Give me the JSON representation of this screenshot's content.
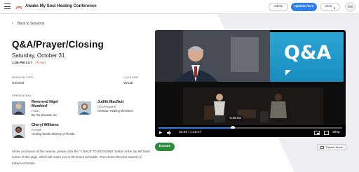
{
  "topbar": {
    "app_title": "Awake My Soul Healing Conference",
    "admin_label": "Admin",
    "update_label": "Update here",
    "view_label": "View",
    "avatar_initials": "KM",
    "accent_color": "#2f7fe8"
  },
  "session": {
    "back_label": "Back to Sessions",
    "title": "Q&A/Prayer/Closing",
    "date": "Saturday, October 31",
    "time": "1:35 PM",
    "timezone": "EDT",
    "duration": "75 min",
    "type_label": "SESSION TYPE",
    "type_value": "General",
    "location_label": "LOCATION",
    "location_value": "Virtual",
    "presenting_label": "PRESENTING",
    "presenters": [
      {
        "name": "Reverend Nigel Mumford",
        "role": "Pastor",
        "org": "By His Wounds, Inc."
      },
      {
        "name": "Judith MacNutt",
        "role": "CEO/President",
        "org": "Christian Healing Ministries"
      },
      {
        "name": "Cheryl Williams",
        "role": "Founder",
        "org": "Healing Words Ministry of Florida"
      }
    ],
    "description": "At the conclusion of this session, please click the \"< BACK TO SESSIONS\" button in the top left hand corner of this page, which will return you to the Event Schedule. Then select the next session in today's schedule."
  },
  "video": {
    "qa_text": "Q&A",
    "tooltip_time": "0:35:53",
    "current_time": "35:59",
    "total_time": "1:28:37",
    "progress_fraction": 0.406,
    "quality": "360p"
  },
  "actions": {
    "donate_label": "Donate",
    "theater_label": "Theater Mode"
  }
}
